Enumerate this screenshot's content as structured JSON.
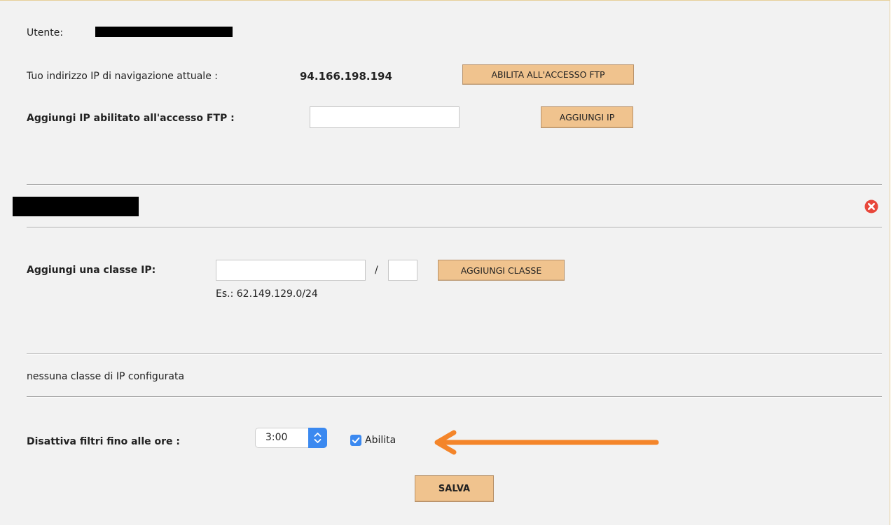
{
  "user": {
    "label": "Utente:"
  },
  "ip_info": {
    "label": "Tuo indirizzo IP di navigazione attuale :",
    "value": "94.166.198.194",
    "enable_ftp_button": "ABILITA ALL'ACCESSO FTP"
  },
  "add_ip": {
    "label": "Aggiungi IP abilitato all'accesso FTP :",
    "input_value": "",
    "button": "AGGIUNGI IP"
  },
  "add_class": {
    "label": "Aggiungi una classe IP:",
    "address_value": "",
    "separator": "/",
    "mask_value": "",
    "button": "AGGIUNGI CLASSE",
    "example": "Es.: 62.149.129.0/24"
  },
  "class_list": {
    "empty_text": "nessuna classe di IP configurata"
  },
  "filters": {
    "label": "Disattiva filtri fino alle ore :",
    "selected_time": "3:00",
    "enable_checked": true,
    "enable_label": "Abilita"
  },
  "save_button": "SALVA",
  "colors": {
    "panel_bg": "#f2f2f2",
    "button_bg": "#f0c38e",
    "accent_blue": "#3b89f0",
    "arrow_orange": "#f4852a",
    "delete_red": "#e8473b"
  },
  "icons": {
    "delete": "close-circle-icon",
    "select_arrows": "chevron-up-down-icon",
    "checkbox": "checkmark-icon",
    "annotation": "arrow-left-icon"
  }
}
